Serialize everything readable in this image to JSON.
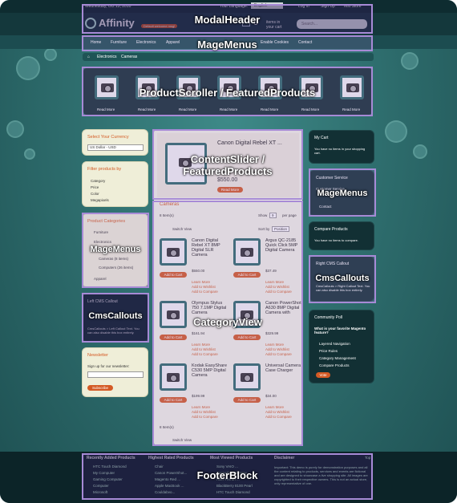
{
  "topbar": {
    "date": "Wednesday, Oct 13, 2010",
    "language_label": "Your Language:",
    "language_value": "English",
    "login": "Log in",
    "signup": "Sign Up",
    "store": "Test Store"
  },
  "header": {
    "logo": "Affinity",
    "tagline": "Default welcome msg!",
    "cart_count": "0",
    "cart_label": "items in your cart",
    "search_placeholder": "Search..."
  },
  "nav": {
    "items": [
      "Home",
      "Furniture",
      "Electronics",
      "Apparel",
      "Enable Cookies",
      "Contact"
    ]
  },
  "breadcrumb": [
    "Home",
    "Electronics",
    "Cameras"
  ],
  "scroller": {
    "read_more": "Read More"
  },
  "currency": {
    "title": "Select Your Currency",
    "value": "US Dollar - USD"
  },
  "filter": {
    "title": "Filter products by",
    "items": [
      "Category",
      "Price",
      "Color",
      "Megapixels"
    ]
  },
  "categories": {
    "title": "Product Categories",
    "items": [
      "Furniture",
      "Electronics",
      "Cameras (8 items)",
      "Computers (26 items)",
      "Apparel"
    ]
  },
  "left_cms": {
    "title": "Left CMS Callout",
    "text": "CmsCallouts > Left Callout Text. You can also disable this box entirely."
  },
  "newsletter": {
    "title": "Newsletter",
    "text": "Sign up for our newsletter:",
    "button": "Subscribe"
  },
  "slider": {
    "title": "Canon Digital Rebel XT ...",
    "price": "$550.00",
    "button": "Read More"
  },
  "category": {
    "title": "Cameras",
    "items_count": "8 Item(s)",
    "show_label": "Show",
    "show_value": "9",
    "per_page": "per page",
    "sort_label": "Sort by",
    "sort_value": "Position",
    "switch_view": "Switch View",
    "products": [
      {
        "name": "Canon Digital Rebel XT 8MP Digital SLR Camera",
        "price": "$550.00",
        "extra": "As low as: $449.00"
      },
      {
        "name": "Argus QC-2185 Quick Click 5MP Digital Camera",
        "price": "$37.49",
        "extra": ""
      },
      {
        "name": "Olympus Stylus 750 7.1MP Digital Camera",
        "price": "$161.94",
        "extra": ""
      },
      {
        "name": "Canon PowerShot A630 8MP Digital Camera with",
        "price": "$329.99",
        "extra": ""
      },
      {
        "name": "Kodak EasyShare C530 5MP Digital Camera",
        "price": "$199.99",
        "extra": ""
      },
      {
        "name": "Universal Camera Case Charger",
        "price": "$34.00",
        "extra": ""
      }
    ],
    "add_to_cart": "Add to Cart",
    "learn_more": "Learn More",
    "wishlist": "Add to Wishlist",
    "compare": "Add to Compare"
  },
  "mycart": {
    "title": "My Cart",
    "text": "You have no items in your shopping cart."
  },
  "service": {
    "title": "Customer Service",
    "items": [
      "Customer Service",
      "Contact"
    ]
  },
  "compare": {
    "title": "Compare Products",
    "text": "You have no items to compare."
  },
  "right_cms": {
    "title": "Right CMS Callout",
    "text": "CmsCallouts > Right Callout Text. You can also disable this box entirely."
  },
  "poll": {
    "title": "Community Poll",
    "question": "What is your favorite Magento feature?",
    "options": [
      "Layered Navigation",
      "Price Rules",
      "Category Management",
      "Compare Products"
    ],
    "button": "Vote"
  },
  "footer": {
    "cols": [
      "Recently Added Products",
      "Highest Rated Products",
      "Most Viewed Products",
      "Disclaimer"
    ],
    "recent": [
      "HTC Touch Diamond",
      "My Computer",
      "Gaming Computer",
      "Computer",
      "Microsoft"
    ],
    "rated": [
      "Chair",
      "Canon PowerShot...",
      "Magento Red ...",
      "Apple MacBook ...",
      "Couldabvo..."
    ],
    "viewed": [
      "Sony VAIO ...",
      "Kenneth Cole New ...",
      "Acer Ferrari ...",
      "BlackBerry 8100 Pearl",
      "HTC Touch Diamond"
    ],
    "disclaimer": "Important: This demo is purely for demonstration purposes and all the content relating to products, services and events are fictional and are designed to showcase a live shopping site. All images are copyrighted to their respective owners. This is not an actual store, only representative of one.",
    "top": "Top"
  },
  "overlays": [
    "ModalHeader",
    "MageMenus",
    "ProductScroller / FeaturedProducts",
    "ContentSlider / FeaturedProducts",
    "MageMenus",
    "MageMenus",
    "CmsCallouts",
    "CategoryView",
    "CmsCallouts",
    "FooterBlock"
  ]
}
